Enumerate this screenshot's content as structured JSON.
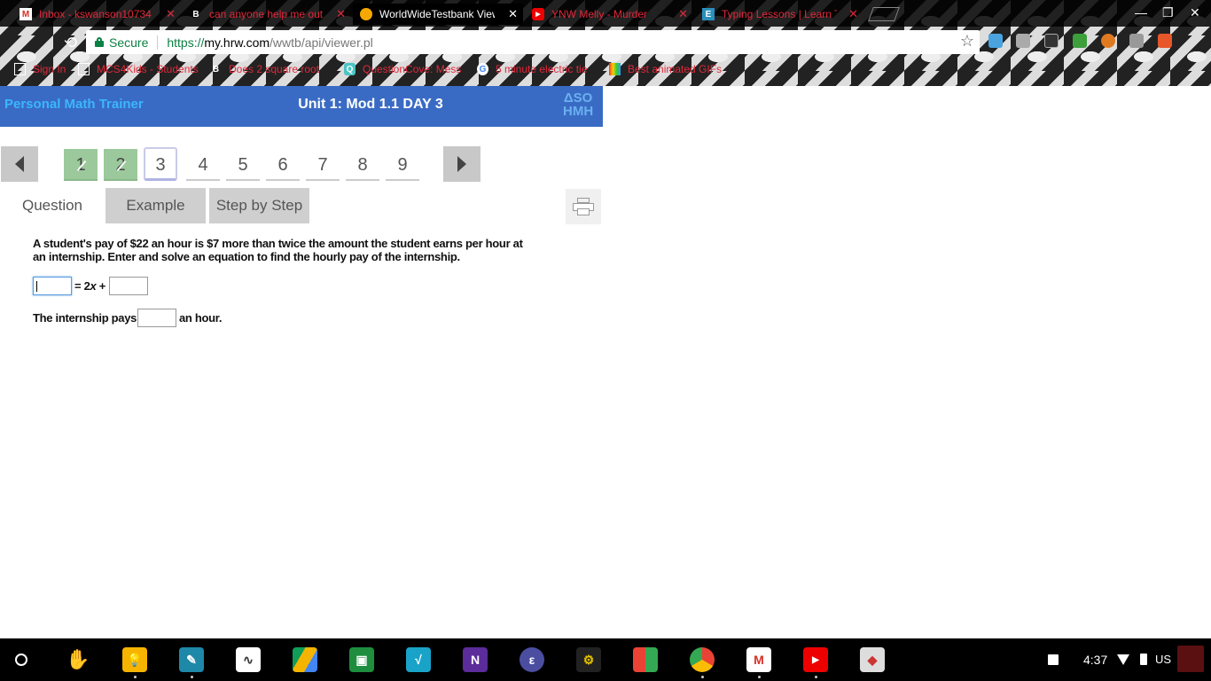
{
  "browser": {
    "tabs": [
      {
        "title": "Inbox - kswanson10734",
        "icon": "gmail-icon"
      },
      {
        "title": "can anyone help me out",
        "icon": "brainly-icon"
      },
      {
        "title": "WorldWideTestbank View",
        "icon": "hmh-favicon"
      },
      {
        "title": "YNW Melly - Murder",
        "icon": "youtube-icon"
      },
      {
        "title": "Typing Lessons | Learn T",
        "icon": "edclub-icon"
      }
    ],
    "active_tab": 2,
    "omnibox": {
      "secure_label": "Secure",
      "url_scheme": "https://",
      "url_host": "my.hrw.com",
      "url_path": "/wwtb/api/viewer.pl"
    },
    "bookmarks": [
      {
        "label": "Sign In",
        "icon": "page-icon"
      },
      {
        "label": "MCS4Kids - Students",
        "icon": "page-icon"
      },
      {
        "label": "Does 2 square root",
        "icon": "brainly-icon"
      },
      {
        "label": "QuestionCove: Mess",
        "icon": "questioncove-icon"
      },
      {
        "label": "5 minute electric tie",
        "icon": "google-icon"
      },
      {
        "label": "Best animated GIFs",
        "icon": "gif-icon"
      }
    ]
  },
  "app": {
    "brand": "Personal Math Trainer",
    "title": "Unit 1: Mod 1.1 DAY 3",
    "logo_top": "ΔЅΟ",
    "logo_bottom": "HMH"
  },
  "nav": {
    "numbers": [
      "1",
      "2",
      "3",
      "4",
      "5",
      "6",
      "7",
      "8",
      "9"
    ],
    "completed": [
      1,
      2
    ],
    "current": 3
  },
  "tabs": {
    "question": "Question",
    "example": "Example",
    "step_by_step": "Step by Step"
  },
  "question": {
    "text": "A student's pay of $22 an hour is $7 more than twice the amount the student earns per hour at an internship. Enter and solve an equation to find the hourly pay of the internship.",
    "equation_middle": "= 2",
    "equation_var": "x",
    "equation_plus": " +",
    "answer_prefix": "The internship pays $",
    "answer_suffix": "an hour.",
    "box1_value": "",
    "box2_value": "",
    "box3_value": ""
  },
  "shelf": {
    "time": "4:37",
    "lang": "US",
    "apps": [
      "keep-icon",
      "pen-icon",
      "desmos-icon",
      "drive-icon",
      "classroom-icon",
      "sqrt-icon",
      "onenote-icon",
      "edpuzzle-icon",
      "settings-icon",
      "sketch-icon",
      "chrome-icon",
      "gmail-icon",
      "youtube-icon",
      "ink-icon"
    ]
  },
  "colors": {
    "header_blue": "#3a6bc4",
    "brand_blue": "#3ab6ff",
    "done_green": "#9bc99b",
    "tab_gray": "#cfcfcf"
  }
}
